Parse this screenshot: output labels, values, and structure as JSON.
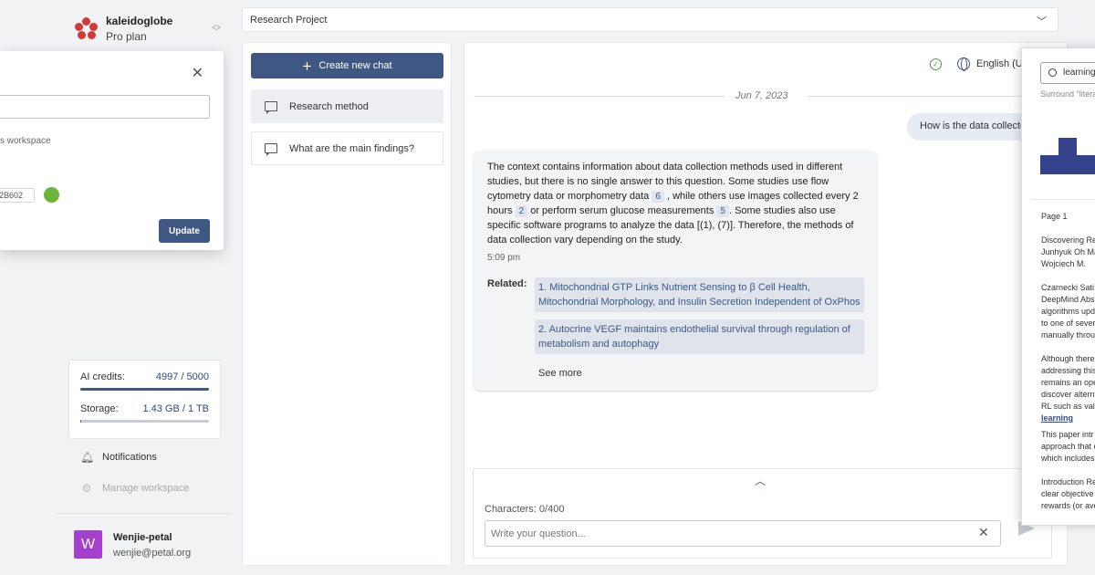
{
  "brand": {
    "name": "kaleidoglobe",
    "plan": "Pro plan"
  },
  "popup": {
    "hint": "s workspace",
    "code": "2B602",
    "update_label": "Update"
  },
  "project": {
    "name": "Research Project"
  },
  "credits": {
    "ai_label": "AI credits:",
    "ai_value": "4997 / 5000",
    "ai_fraction": 0.9994,
    "storage_label": "Storage:",
    "storage_value": "1.43 GB / 1 TB",
    "storage_fraction": 0.0014
  },
  "sidebar": {
    "notifications": "Notifications",
    "manage": "Manage workspace"
  },
  "user": {
    "initial": "W",
    "name": "Wenjie-petal",
    "email": "wenjie@petal.org"
  },
  "chats": {
    "new_label": "Create new chat",
    "items": [
      {
        "label": "Research method"
      },
      {
        "label": "What are the main findings?"
      }
    ]
  },
  "chat": {
    "language": "English (US)",
    "date": "Jun 7, 2023",
    "user_message": "How is the data collected?",
    "answer_parts": [
      "The context contains information about data collection methods used in different studies, but there is no single answer to this question. Some studies use flow cytometry data or morphometry data ",
      " , while others use images collected every 2 hours ",
      " or perform serum glucose measurements ",
      ". Some studies also use specific software programs to analyze the data [(1), (7)]. Therefore, the methods of data collection vary depending on the study."
    ],
    "citations": [
      "6",
      "2",
      "5"
    ],
    "time": "5:09 pm",
    "related_label": "Related:",
    "related": [
      "1. Mitochondrial GTP Links Nutrient Sensing to β Cell Health, Mitochondrial Morphology, and Insulin Secretion Independent of OxPhos",
      "2. Autocrine VEGF maintains endothelial survival through regulation of metabolism and autophagy"
    ],
    "see_more": "See more",
    "characters": "Characters: 0/400",
    "input_placeholder": "Write your question..."
  },
  "viewer": {
    "search_value": "learning",
    "hint": "Surround \"literal",
    "page": "Page 1",
    "lines": [
      "Discovering Re",
      "Junhyuk Oh Ma",
      "Wojciech M.",
      "Czarnecki Sati",
      "DeepMind Abs",
      "algorithms upd",
      "to one of sever",
      "manually throu",
      "Although there",
      "addressing this",
      "remains an ope",
      "discover altern",
      "RL such as val",
      "This paper intr",
      "approach that c",
      "which includes",
      "Introduction Re",
      "clear objective",
      "rewards (or ave"
    ],
    "highlight": "learning",
    "histogram": [
      0.5,
      0.95,
      0.5,
      0.15
    ]
  },
  "colors": {
    "accent": "#3f5783",
    "ok": "#4a9b4a",
    "avatar": "#a53fcf",
    "highlight": "#33428a"
  }
}
